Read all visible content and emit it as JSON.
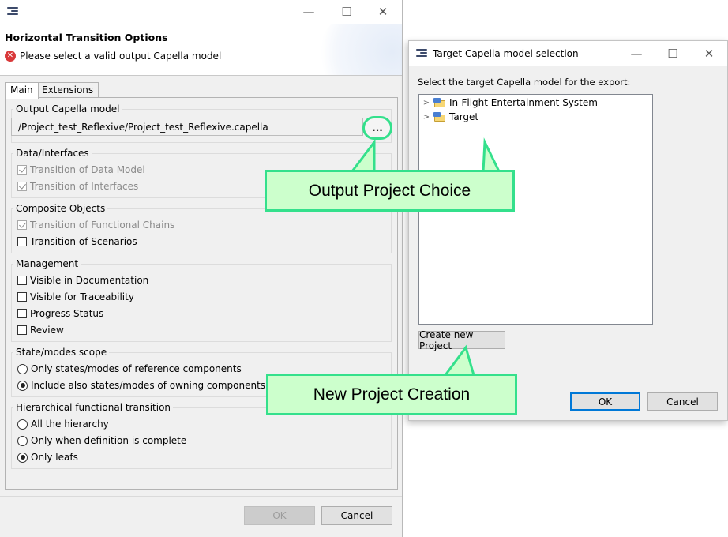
{
  "wizard": {
    "title": "Horizontal Transition Options",
    "error_message": "Please select a valid output Capella model",
    "tabs": [
      {
        "label": "Main",
        "active": true
      },
      {
        "label": "Extensions",
        "active": false
      }
    ],
    "output_model": {
      "legend": "Output Capella model",
      "path": "/Project_test_Reflexive/Project_test_Reflexive.capella",
      "browse_label": "..."
    },
    "data_interfaces": {
      "legend": "Data/Interfaces",
      "items": [
        {
          "label": "Transition of Data Model",
          "checked": true,
          "enabled": false
        },
        {
          "label": "Transition of Interfaces",
          "checked": true,
          "enabled": false
        }
      ]
    },
    "composite_objects": {
      "legend": "Composite Objects",
      "items": [
        {
          "label": "Transition of Functional Chains",
          "checked": true,
          "enabled": false
        },
        {
          "label": "Transition of Scenarios",
          "checked": false,
          "enabled": true
        }
      ]
    },
    "management": {
      "legend": "Management",
      "items": [
        {
          "label": "Visible in Documentation",
          "checked": false
        },
        {
          "label": "Visible for Traceability",
          "checked": false
        },
        {
          "label": "Progress Status",
          "checked": false
        },
        {
          "label": "Review",
          "checked": false
        }
      ]
    },
    "state_modes": {
      "legend": "State/modes scope",
      "options": [
        {
          "label": "Only states/modes of reference components",
          "selected": false
        },
        {
          "label": "Include also states/modes of owning components of refe",
          "selected": true
        }
      ]
    },
    "hierarchical": {
      "legend": "Hierarchical functional transition",
      "options": [
        {
          "label": "All the hierarchy",
          "selected": false
        },
        {
          "label": "Only when definition is complete",
          "selected": false
        },
        {
          "label": "Only leafs",
          "selected": true
        }
      ]
    },
    "ok_label": "OK",
    "cancel_label": "Cancel"
  },
  "selection_dialog": {
    "title": "Target Capella model selection",
    "instruction": "Select the target Capella model for the export:",
    "tree_items": [
      {
        "label": "In-Flight Entertainment System"
      },
      {
        "label": "Target"
      }
    ],
    "create_project_label": "Create new Project",
    "ok_label": "OK",
    "cancel_label": "Cancel"
  },
  "window_controls": {
    "minimize": "—",
    "maximize": "☐",
    "close": "✕"
  },
  "callouts": {
    "output_project": "Output Project Choice",
    "new_project": "New Project Creation"
  },
  "colors": {
    "callout_fill": "#ccffcc",
    "callout_border": "#34e08c",
    "error_red": "#d9393a"
  }
}
